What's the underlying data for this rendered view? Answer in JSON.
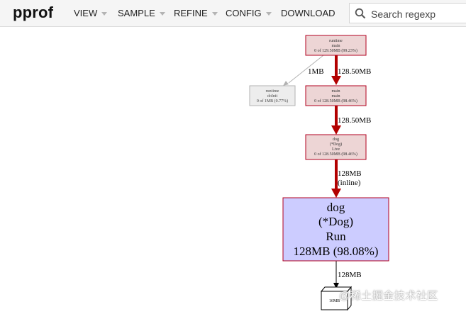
{
  "app": {
    "title": "pprof"
  },
  "menu": [
    {
      "label": "VIEW"
    },
    {
      "label": "SAMPLE"
    },
    {
      "label": "REFINE"
    },
    {
      "label": "CONFIG"
    },
    {
      "label": "DOWNLOAD"
    }
  ],
  "search": {
    "placeholder": "Search regexp",
    "icon": "search-icon"
  },
  "graph": {
    "nodes": {
      "runtime_main": {
        "lines": [
          "runtime",
          "main",
          "0 of 129.50MB (99.23%)"
        ]
      },
      "main_main": {
        "lines": [
          "main",
          "main",
          "0 of 128.50MB (98.46%)"
        ]
      },
      "runtime_doInit": {
        "lines": [
          "runtime",
          "doInit",
          "0 of 1MB (0.77%)"
        ]
      },
      "dog_live": {
        "lines": [
          "dog",
          "(*Dog)",
          "Live",
          "0 of 128.50MB (98.46%)"
        ]
      },
      "dog_run": {
        "lines": [
          "dog",
          "(*Dog)",
          "Run",
          "128MB (98.08%)"
        ]
      },
      "leaf": {
        "label": "16MB"
      }
    },
    "edges": {
      "e1": "128.50MB",
      "e2": "1MB",
      "e3": "128.50MB",
      "e4_line1": "128MB",
      "e4_line2": "(inline)",
      "e5": "128MB"
    }
  },
  "watermark": "@稀土掘金技术社区",
  "colors": {
    "hot_node_fill": "#edd5d5",
    "hot_node_border": "#b2001f",
    "hot_edge": "#b20000",
    "cool_node_fill": "#ededed",
    "cool_node_border": "#b2b2b2",
    "focus_node_fill": "#ccccff"
  }
}
